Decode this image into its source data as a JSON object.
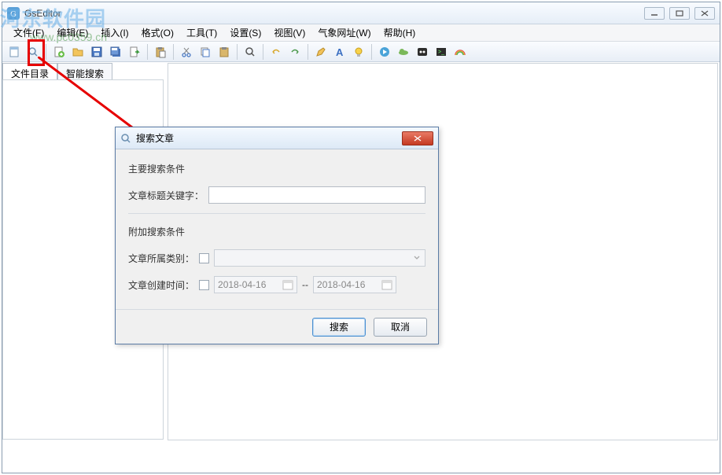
{
  "window": {
    "title": "GsEditor"
  },
  "watermark": {
    "cn": "河东软件园",
    "url": "www.pc0359.cn"
  },
  "menus": {
    "file": "文件(F)",
    "edit": "编辑(E)",
    "insert": "插入(I)",
    "format": "格式(O)",
    "tools": "工具(T)",
    "settings": "设置(S)",
    "view": "视图(V)",
    "weather": "气象网址(W)",
    "help": "帮助(H)"
  },
  "tabs": {
    "files": "文件目录",
    "search": "智能搜索"
  },
  "dialog": {
    "title": "搜索文章",
    "section_main": "主要搜索条件",
    "label_keyword": "文章标题关键字：",
    "section_extra": "附加搜索条件",
    "label_category": "文章所属类别：",
    "label_created": "文章创建时间：",
    "date_from": "2018-04-16",
    "date_sep": "--",
    "date_to": "2018-04-16",
    "btn_search": "搜索",
    "btn_cancel": "取消"
  }
}
